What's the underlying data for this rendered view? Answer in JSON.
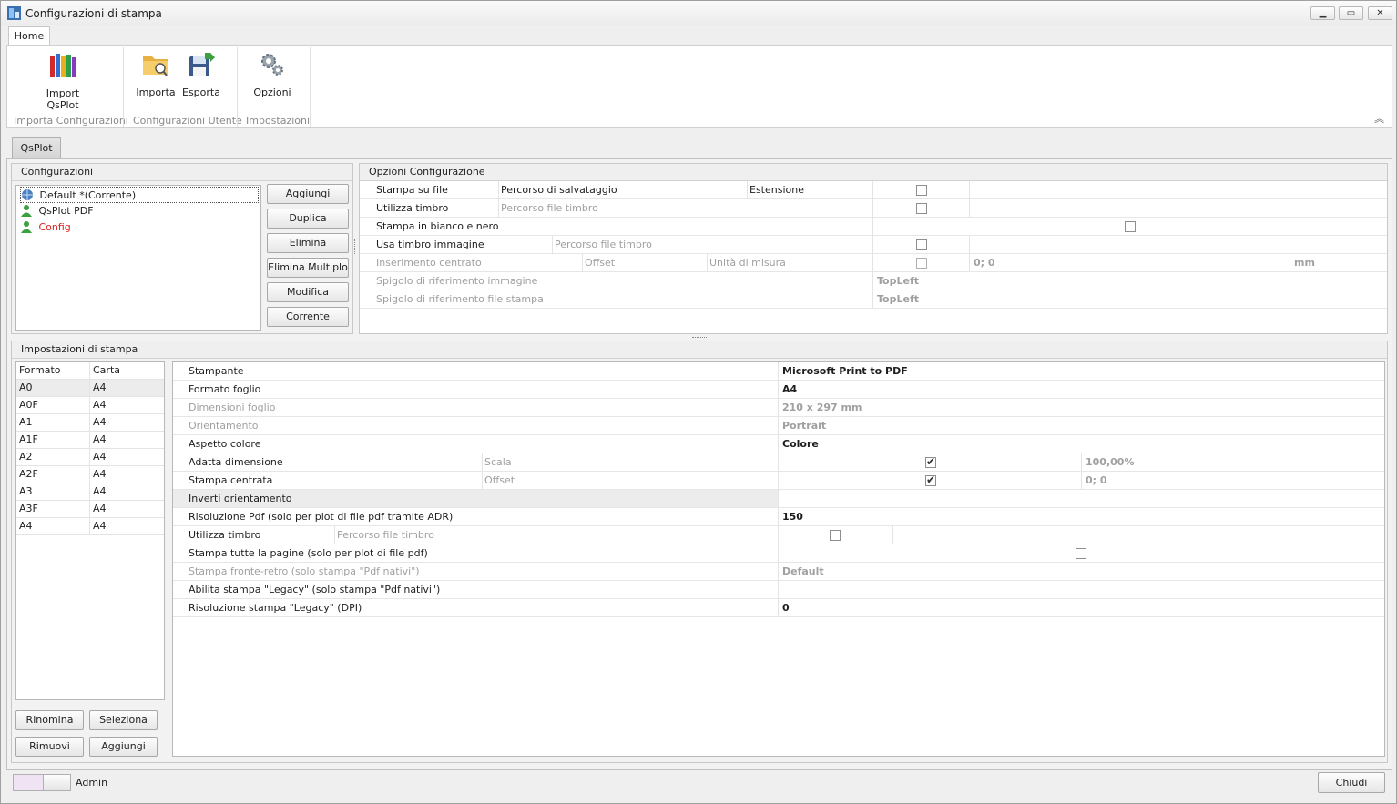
{
  "window": {
    "title": "Configurazioni di stampa"
  },
  "ribbon": {
    "tab": "Home",
    "groups": [
      {
        "caption": "Importa Configurazioni",
        "buttons": [
          "Import\nQsPlot"
        ]
      },
      {
        "caption": "Configurazioni Utente",
        "buttons": [
          "Importa",
          "Esporta"
        ]
      },
      {
        "caption": "Impostazioni",
        "buttons": [
          "Opzioni"
        ]
      }
    ],
    "import_label_1": "Import",
    "import_label_2": "QsPlot",
    "importa_label": "Importa",
    "esporta_label": "Esporta",
    "opzioni_label": "Opzioni",
    "cap_importa_config": "Importa Configurazioni",
    "cap_config_utente": "Configurazioni Utente",
    "cap_impostazioni": "Impostazioni"
  },
  "doc_tab": "QsPlot",
  "configurazioni": {
    "header": "Configurazioni",
    "items": [
      {
        "label": "Default *(Corrente)",
        "icon": "globe-user-icon",
        "selected": true
      },
      {
        "label": "QsPlot PDF",
        "icon": "user-icon"
      },
      {
        "label": "Config",
        "icon": "user-icon",
        "color": "#e02020"
      }
    ],
    "buttons": {
      "aggiungi": "Aggiungi",
      "duplica": "Duplica",
      "elimina": "Elimina",
      "elimina_multiplo": "Elimina Multiplo",
      "modifica": "Modifica",
      "corrente": "Corrente"
    }
  },
  "opzioni": {
    "header": "Opzioni Configurazione",
    "stampa_su_file": "Stampa su file",
    "percorso_salvataggio": "Percorso di salvataggio",
    "estensione": "Estensione",
    "utilizza_timbro": "Utilizza timbro",
    "percorso_file_timbro": "Percorso file timbro",
    "bianco_nero": "Stampa in bianco e nero",
    "usa_timbro_immagine": "Usa timbro immagine",
    "percorso_file_timbro_2": "Percorso file timbro",
    "inserimento_centrato": "Inserimento centrato",
    "offset": "Offset",
    "unita_misura": "Unità di misura",
    "offset_value": "0; 0",
    "unit_value": "mm",
    "spigolo_immagine": "Spigolo di riferimento immagine",
    "spigolo_immagine_value": "TopLeft",
    "spigolo_file": "Spigolo di riferimento file stampa",
    "spigolo_file_value": "TopLeft"
  },
  "impostazioni": {
    "header": "Impostazioni di stampa",
    "grid": {
      "columns": [
        "Formato",
        "Carta"
      ],
      "rows": [
        [
          "A0",
          "A4"
        ],
        [
          "A0F",
          "A4"
        ],
        [
          "A1",
          "A4"
        ],
        [
          "A1F",
          "A4"
        ],
        [
          "A2",
          "A4"
        ],
        [
          "A2F",
          "A4"
        ],
        [
          "A3",
          "A4"
        ],
        [
          "A3F",
          "A4"
        ],
        [
          "A4",
          "A4"
        ]
      ]
    },
    "buttons": {
      "rinomina": "Rinomina",
      "seleziona": "Seleziona",
      "rimuovi": "Rimuovi",
      "aggiungi": "Aggiungi"
    },
    "props": {
      "stampante": "Stampante",
      "stampante_value": "Microsoft Print to PDF",
      "formato_foglio": "Formato foglio",
      "formato_foglio_value": "A4",
      "dimensioni_foglio": "Dimensioni foglio",
      "dimensioni_foglio_value": "210 x 297 mm",
      "orientamento": "Orientamento",
      "orientamento_value": "Portrait",
      "aspetto_colore": "Aspetto colore",
      "aspetto_colore_value": "Colore",
      "adatta_dimensione": "Adatta dimensione",
      "scala": "Scala",
      "scala_value": "100,00%",
      "stampa_centrata": "Stampa centrata",
      "offset": "Offset",
      "offset_value": "0; 0",
      "inverti": "Inverti orientamento",
      "risoluzione_pdf": "Risoluzione Pdf (solo per plot di file pdf tramite ADR)",
      "risoluzione_pdf_value": "150",
      "utilizza_timbro": "Utilizza timbro",
      "percorso_file_timbro": "Percorso file timbro",
      "tutte_pagine": "Stampa tutte la pagine (solo per plot di file pdf)",
      "fronte_retro": "Stampa fronte-retro (solo stampa \"Pdf nativi\")",
      "fronte_retro_value": "Default",
      "legacy": "Abilita stampa \"Legacy\" (solo stampa \"Pdf nativi\")",
      "risoluzione_legacy": "Risoluzione stampa \"Legacy\" (DPI)",
      "risoluzione_legacy_value": "0"
    }
  },
  "footer": {
    "admin_label": "Admin",
    "chiudi": "Chiudi"
  },
  "colors": {
    "accent": "#4a7fc1",
    "error": "#e02020",
    "user": "#3aa040"
  }
}
